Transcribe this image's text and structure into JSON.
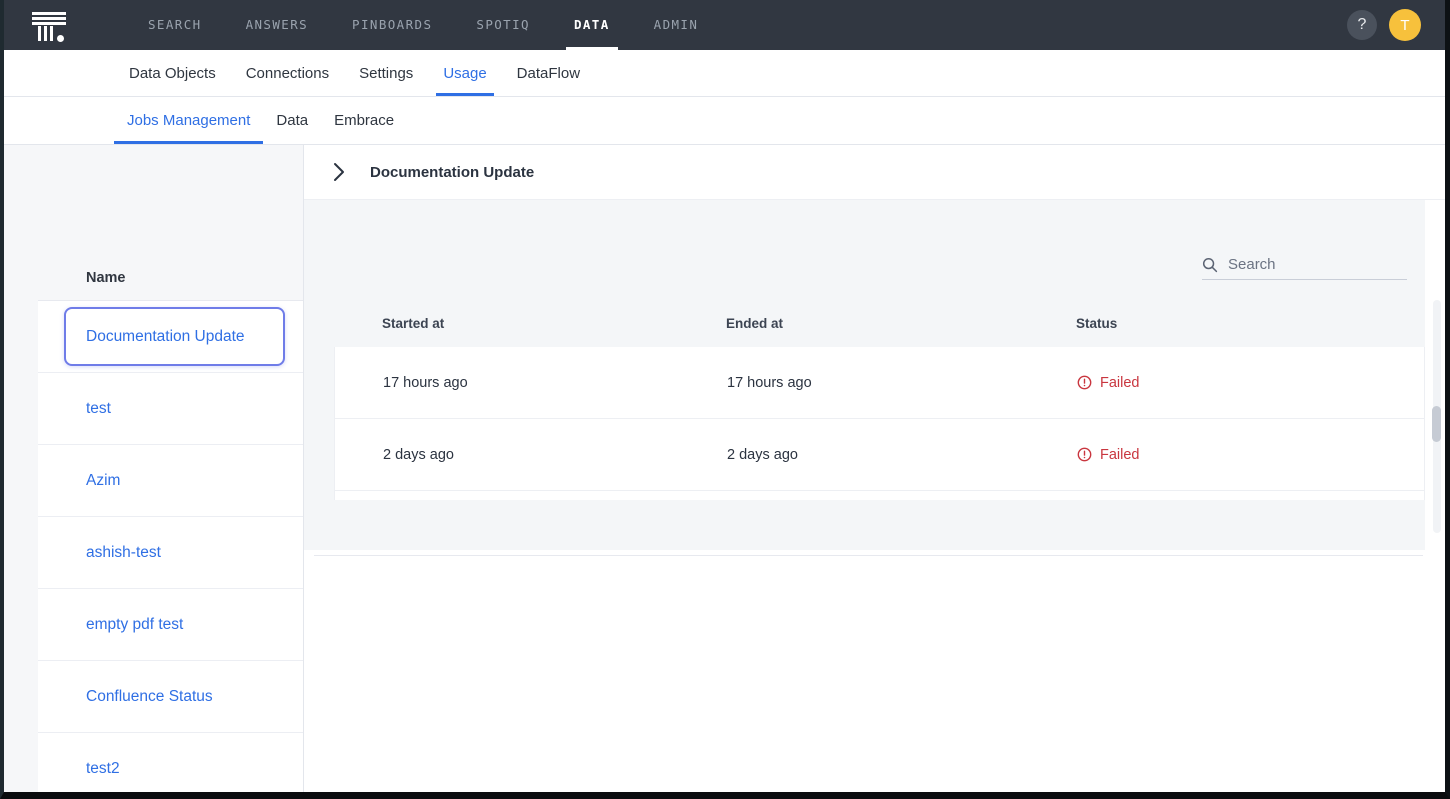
{
  "topnav": {
    "logo_name": "thoughtspot-logo",
    "items": [
      {
        "label": "SEARCH",
        "active": false
      },
      {
        "label": "ANSWERS",
        "active": false
      },
      {
        "label": "PINBOARDS",
        "active": false
      },
      {
        "label": "SPOTIQ",
        "active": false
      },
      {
        "label": "DATA",
        "active": true
      },
      {
        "label": "ADMIN",
        "active": false
      }
    ],
    "help_label": "?",
    "avatar_label": "T",
    "avatar_color": "#f7c13c",
    "background": "#313741"
  },
  "subnav": {
    "items": [
      {
        "label": "Data Objects",
        "active": false
      },
      {
        "label": "Connections",
        "active": false
      },
      {
        "label": "Settings",
        "active": false
      },
      {
        "label": "Usage",
        "active": true
      },
      {
        "label": "DataFlow",
        "active": false
      }
    ],
    "accent": "#2f6fe4"
  },
  "tabnav": {
    "items": [
      {
        "label": "Jobs Management",
        "active": true
      },
      {
        "label": "Data",
        "active": false
      },
      {
        "label": "Embrace",
        "active": false
      }
    ]
  },
  "sidebar": {
    "column_header": "Name",
    "items": [
      {
        "label": "Documentation Update",
        "selected": true
      },
      {
        "label": "test",
        "selected": false
      },
      {
        "label": "Azim",
        "selected": false
      },
      {
        "label": "ashish-test",
        "selected": false
      },
      {
        "label": "empty pdf test",
        "selected": false
      },
      {
        "label": "Confluence Status",
        "selected": false
      },
      {
        "label": "test2",
        "selected": false
      }
    ],
    "selected_outline_color": "#6f7ce8",
    "link_color": "#2f6fe4"
  },
  "panel": {
    "expand_icon": "chevron-right-icon",
    "title": "Documentation Update"
  },
  "search": {
    "icon": "search-icon",
    "placeholder": "Search",
    "value": ""
  },
  "table": {
    "headers": {
      "started_at": "Started at",
      "ended_at": "Ended at",
      "status": "Status"
    },
    "rows": [
      {
        "started_at": "17 hours ago",
        "ended_at": "17 hours ago",
        "status": "Failed",
        "status_icon": "error-circle-icon"
      },
      {
        "started_at": "2 days ago",
        "ended_at": "2 days ago",
        "status": "Failed",
        "status_icon": "error-circle-icon"
      }
    ],
    "status_color": "#c9363f"
  }
}
